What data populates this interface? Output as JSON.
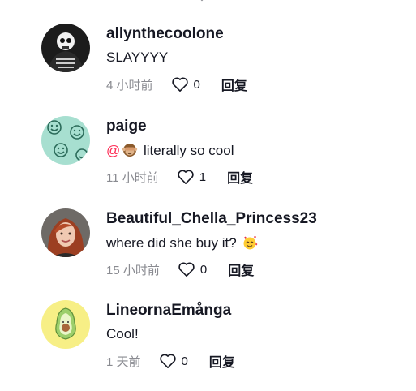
{
  "comments": [
    {
      "username": "allynthecoolone",
      "text": "SLAYYYY",
      "time": "4 小时前",
      "likes": "0",
      "reply_label": "回复",
      "avatar": "black-skeleton-avatar"
    },
    {
      "username": "paige",
      "mention": "@",
      "emoji": "see-no-evil-monkey-emoji",
      "text": "literally so cool",
      "time": "11 小时前",
      "likes": "1",
      "reply_label": "回复",
      "avatar": "mint-smiley-pattern-avatar"
    },
    {
      "username": "Beautiful_Chella_Princess23",
      "text": "where did she buy it?",
      "emoji": "smiling-face-with-hearts-emoji",
      "time": "15 小时前",
      "likes": "0",
      "reply_label": "回复",
      "avatar": "red-hair-portrait-avatar"
    },
    {
      "username": "LineornaEmånga",
      "text": "Cool!",
      "time": "1 天前",
      "likes": "0",
      "reply_label": "回复",
      "avatar": "avocado-avatar"
    }
  ],
  "colors": {
    "text": "#161823",
    "secondary": "#8a8b91",
    "mention": "#fe2c55"
  }
}
